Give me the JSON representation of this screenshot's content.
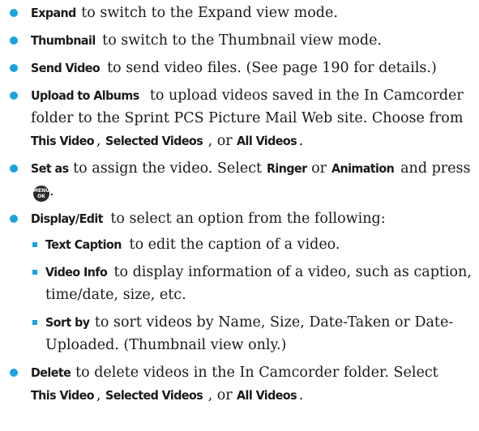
{
  "items": [
    {
      "term": "Expand",
      "text": " to switch to the Expand view mode."
    },
    {
      "term": "Thumbnail",
      "text": " to switch to the Thumbnail view mode."
    },
    {
      "term": "Send Video",
      "text": " to send video files. (See page 190 for details.)"
    },
    {
      "term": "Upload to Albums",
      "text1": " to upload videos saved in the In Camcorder folder to the Sprint PCS Picture Mail Web site. Choose from ",
      "opt1": "This Video",
      "sep1": ", ",
      "opt2": "Selected Videos",
      "sep2": ", or ",
      "opt3": "All Videos",
      "end": "."
    },
    {
      "term": "Set as",
      "text1": " to assign the video. Select ",
      "opt1": "Ringer",
      "sep1": " or ",
      "opt2": "Animation",
      "text2": " and press",
      "end": "."
    },
    {
      "term": "Display/Edit",
      "text": " to select an option from the following:",
      "sub": [
        {
          "term": "Text Caption",
          "text": " to edit the caption of a video."
        },
        {
          "term": "Video Info",
          "text": " to display information of a video, such as caption, time/date, size, etc."
        },
        {
          "term": "Sort by",
          "text": " to sort videos by Name, Size, Date-Taken or Date-Uploaded. (Thumbnail view only.)"
        }
      ]
    },
    {
      "term": "Delete",
      "text1": " to delete videos in the In Camcorder folder. Select ",
      "opt1": "This Video",
      "sep1": ", ",
      "opt2": "Selected Videos",
      "sep2": ", or ",
      "opt3": "All Videos",
      "end": "."
    }
  ],
  "menu_key": {
    "icon": "menu-ok-key-icon",
    "line1": "MENU",
    "line2": "OK"
  },
  "colors": {
    "bullet": "#1aa3e0",
    "text": "#1a1a1a",
    "key": "#2b2b2b"
  }
}
